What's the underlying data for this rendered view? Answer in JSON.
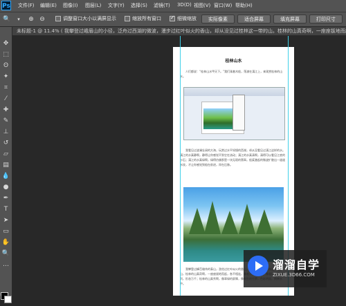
{
  "app": {
    "logo": "Ps"
  },
  "menubar": {
    "items": [
      "文件(F)",
      "编辑(E)",
      "图像(I)",
      "图层(L)",
      "文字(Y)",
      "选择(S)",
      "滤镜(T)",
      "3D(D)",
      "视图(V)",
      "窗口(W)",
      "帮助(H)"
    ]
  },
  "options": {
    "tool_icon": "zoom-icon",
    "zoom_in_icon": "zoom-in-icon",
    "zoom_out_icon": "zoom-out-icon",
    "checkboxes": [
      {
        "label": "调整窗口大小以满屏显示",
        "checked": false
      },
      {
        "label": "缩放所有窗口",
        "checked": false
      },
      {
        "label": "细微缩放",
        "checked": true
      }
    ],
    "buttons": [
      "实际像素",
      "适合屏幕",
      "填充屏幕",
      "打印尺寸"
    ]
  },
  "document": {
    "tab_title": "未标题-1 @ 11.4% (",
    "tab_extra": "我攀登过峨眉山的小径，泛舟过西湖的微波，漫步过红叶似火的香山，却从没见过桂林这一带的山。桂林的山真奇啊，一座座拔地而起"
  },
  "page": {
    "title": "桂林山水",
    "para1": "人们都说：“桂林山水甲天下。”我们乘着木船，荡漾在漓江上，来观赏桂林的山水。",
    "para2": "我看见过波澜壮阔的大海，玩赏过水平如镜的西湖，却从没看见过漓江这样的水。漓江的水真静啊，静得让你感觉不到它在流动；漓江的水真清啊，清得可以看见江底的沙石；漓江的水真绿啊，绿得仿佛那是一块无瑕的翡翠。船桨激起的微波扩散出一道道水纹，才让你感觉到船在前进，岸在后移。",
    "para3": "我攀登过峰峦雄伟的泰山，游览过红叶似火的香山，却从没看见过桂林这一带的山，桂林的山真奇啊，一座座拔地而起，各不相连，像老人，像巨象，像骆驼，奇峰罗列，形态万千；桂林的山真秀啊，像翠绿的屏障，像新生的竹笋，色彩明丽，倒映水中。"
  },
  "watermark": {
    "title": "溜溜自学",
    "url": "ZIXUE.3D66.COM"
  },
  "tools": [
    "move-icon",
    "marquee-icon",
    "lasso-icon",
    "magic-wand-icon",
    "crop-icon",
    "eyedropper-icon",
    "healing-brush-icon",
    "brush-icon",
    "clone-stamp-icon",
    "history-brush-icon",
    "eraser-icon",
    "gradient-icon",
    "blur-icon",
    "dodge-icon",
    "pen-icon",
    "type-icon",
    "path-select-icon",
    "rectangle-icon",
    "hand-icon",
    "zoom-icon"
  ]
}
